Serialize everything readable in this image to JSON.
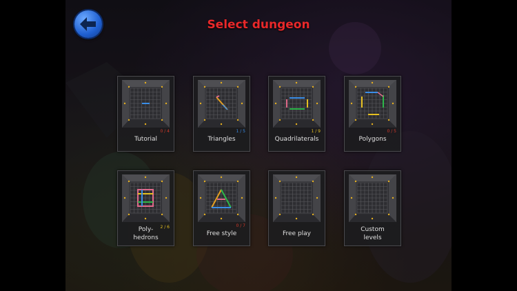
{
  "screen": {
    "title": "Select dungeon",
    "back_icon": "arrow-left-icon"
  },
  "colors": {
    "title": "#e8282a",
    "back_button": "#2f74e6",
    "progress_red": "#d43a2a",
    "progress_blue": "#3a8ee8",
    "progress_yellow": "#e6c020"
  },
  "dungeons": [
    {
      "label": "Tutorial",
      "progress": "0 / 4",
      "progress_color": "#d43a2a",
      "icon": "tutorial-board-icon"
    },
    {
      "label": "Triangles",
      "progress": "1 / 5",
      "progress_color": "#3a8ee8",
      "icon": "triangles-board-icon"
    },
    {
      "label": "Quadrilaterals",
      "progress": "1 / 9",
      "progress_color": "#e6c020",
      "icon": "quadrilaterals-board-icon"
    },
    {
      "label": "Polygons",
      "progress": "0 / 5",
      "progress_color": "#d43a2a",
      "icon": "polygons-board-icon"
    },
    {
      "label": "Poly-\nhedrons",
      "progress": "2 / 6",
      "progress_color": "#e6c020",
      "icon": "polyhedrons-board-icon"
    },
    {
      "label": "Free style",
      "progress": "0 / 7",
      "progress_color": "#d43a2a",
      "icon": "free-style-board-icon"
    },
    {
      "label": "Free play",
      "progress": "",
      "progress_color": "",
      "icon": "free-play-board-icon"
    },
    {
      "label": "Custom\nlevels",
      "progress": "",
      "progress_color": "",
      "icon": "custom-levels-board-icon"
    }
  ]
}
